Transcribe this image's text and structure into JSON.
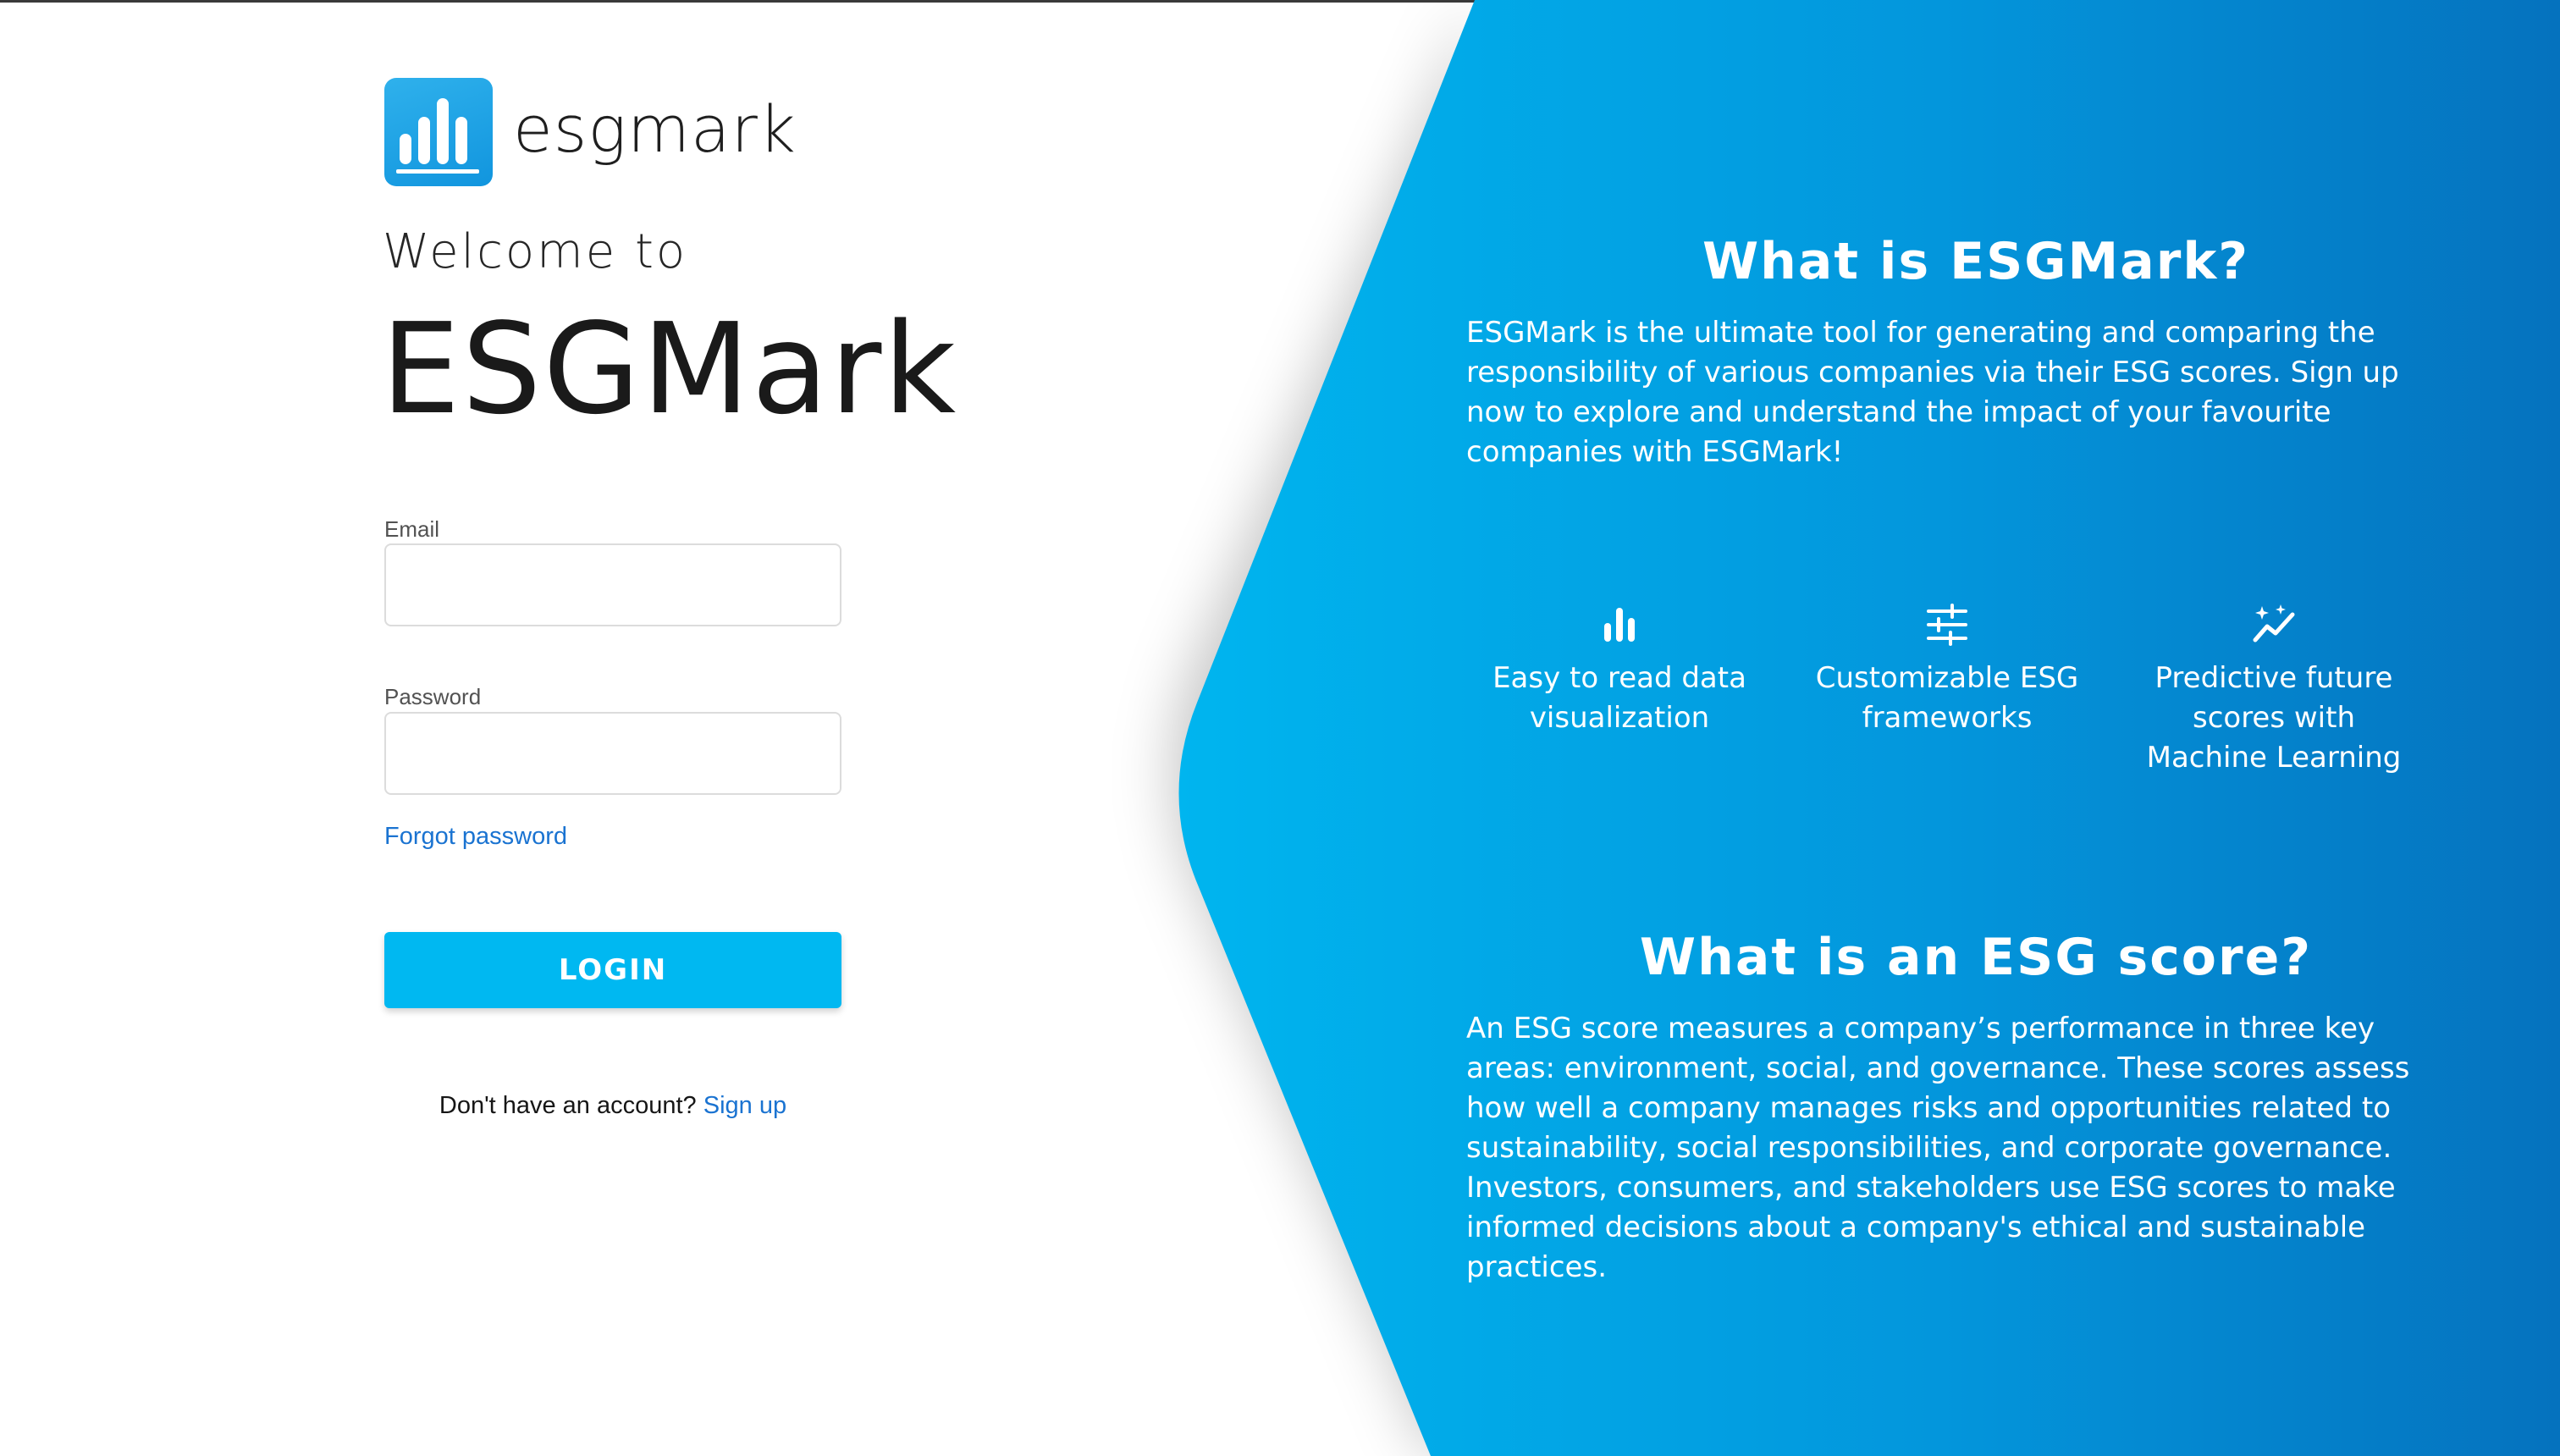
{
  "logo": {
    "text": "esgmark",
    "icon": "bar-chart-logo-icon"
  },
  "welcome": {
    "line1": "Welcome to",
    "title": "ESGMark"
  },
  "form": {
    "email_label": "Email",
    "email_value": "",
    "password_label": "Password",
    "password_value": "",
    "forgot_label": "Forgot password",
    "login_label": "LOGIN",
    "signup_prompt": "Don't have an account?",
    "signup_link": "Sign up"
  },
  "info": {
    "what_is_heading": "What is ESGMark?",
    "what_is_text": "ESGMark is the ultimate tool for generating and comparing the responsibility of various companies via their ESG scores. Sign up now to explore and understand the impact of your favourite companies with ESGMark!",
    "features": [
      {
        "icon": "bar-chart-icon",
        "label": "Easy to read data visualization"
      },
      {
        "icon": "sliders-icon",
        "label": "Customizable ESG frameworks"
      },
      {
        "icon": "sparkle-trend-icon",
        "label": "Predictive future scores with Machine Learning"
      }
    ],
    "score_heading": "What is an ESG score?",
    "score_text": "An ESG score measures a company’s performance in three key areas: environment, social, and governance. These scores assess how well a company manages risks and opportunities related to sustainability, social responsibilities, and corporate governance. Investors, consumers, and stakeholders use ESG scores to make informed decisions about a company's ethical and sustainable practices."
  },
  "colors": {
    "brand_blue": "#00b8f1",
    "link_blue": "#1a73d1",
    "panel_gradient_start": "#00b2ec",
    "panel_gradient_end": "#0573bf"
  }
}
